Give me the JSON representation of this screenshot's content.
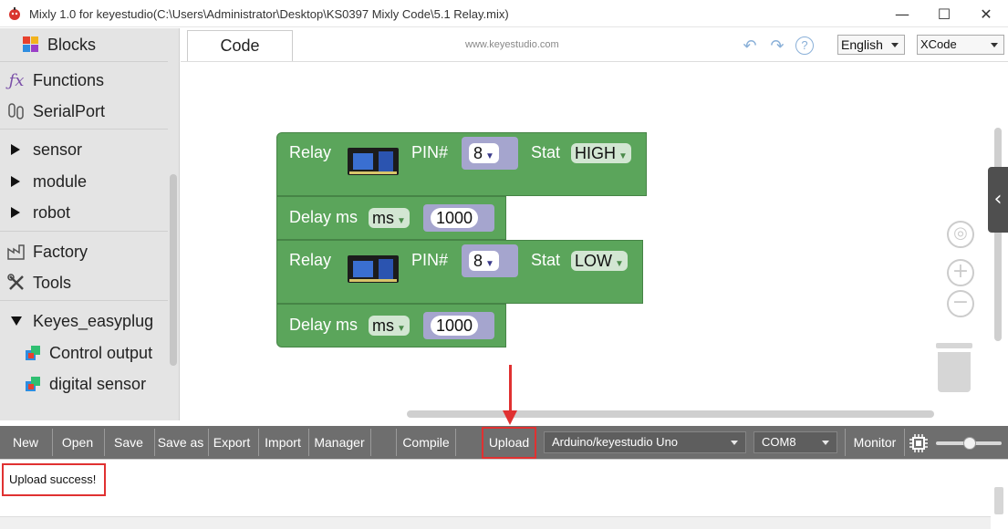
{
  "window": {
    "title": "Mixly 1.0 for keyestudio(C:\\Users\\Administrator\\Desktop\\KS0397 Mixly Code\\5.1 Relay.mix)",
    "minimize": "—",
    "maximize": "☐",
    "close": "✕"
  },
  "sidebar": {
    "items": [
      {
        "label": "Blocks",
        "icon": "puzzle-icon"
      },
      {
        "label": "Functions",
        "icon": "fx-icon"
      },
      {
        "label": "SerialPort",
        "icon": "serial-icon"
      },
      {
        "label": "sensor",
        "icon": "expand-triangle"
      },
      {
        "label": "module",
        "icon": "expand-triangle"
      },
      {
        "label": "robot",
        "icon": "expand-triangle"
      },
      {
        "label": "Factory",
        "icon": "factory-icon"
      },
      {
        "label": "Tools",
        "icon": "tools-icon"
      },
      {
        "label": "Keyes_easyplug",
        "icon": "collapse-triangle"
      },
      {
        "label": "Control output",
        "icon": "cube-icon"
      },
      {
        "label": "digital sensor",
        "icon": "cube-icon"
      }
    ]
  },
  "tabs": {
    "code": "Code",
    "site": "www.keyestudio.com",
    "help": "?",
    "language": "English",
    "theme": "XCode"
  },
  "blocks": {
    "relay1": {
      "label": "Relay",
      "pin_label": "PIN#",
      "pin": "8",
      "stat_label": "Stat",
      "stat": "HIGH"
    },
    "delay1": {
      "label": "Delay ms",
      "unit": "ms",
      "value": "1000"
    },
    "relay2": {
      "label": "Relay",
      "pin_label": "PIN#",
      "pin": "8",
      "stat_label": "Stat",
      "stat": "LOW"
    },
    "delay2": {
      "label": "Delay ms",
      "unit": "ms",
      "value": "1000"
    },
    "dropdown_glyph": "▼"
  },
  "toolbar": {
    "new": "New",
    "open": "Open",
    "save": "Save",
    "save_as": "Save as",
    "export": "Export",
    "import": "Import",
    "manager": "Manager",
    "compile": "Compile",
    "upload": "Upload",
    "board": "Arduino/keyestudio Uno",
    "port": "COM8",
    "monitor": "Monitor"
  },
  "output": {
    "message": "Upload success!"
  },
  "colors": {
    "block_green": "#5ba55b",
    "toolbar_gray": "#6e6e6e",
    "highlight_red": "#e03131"
  }
}
